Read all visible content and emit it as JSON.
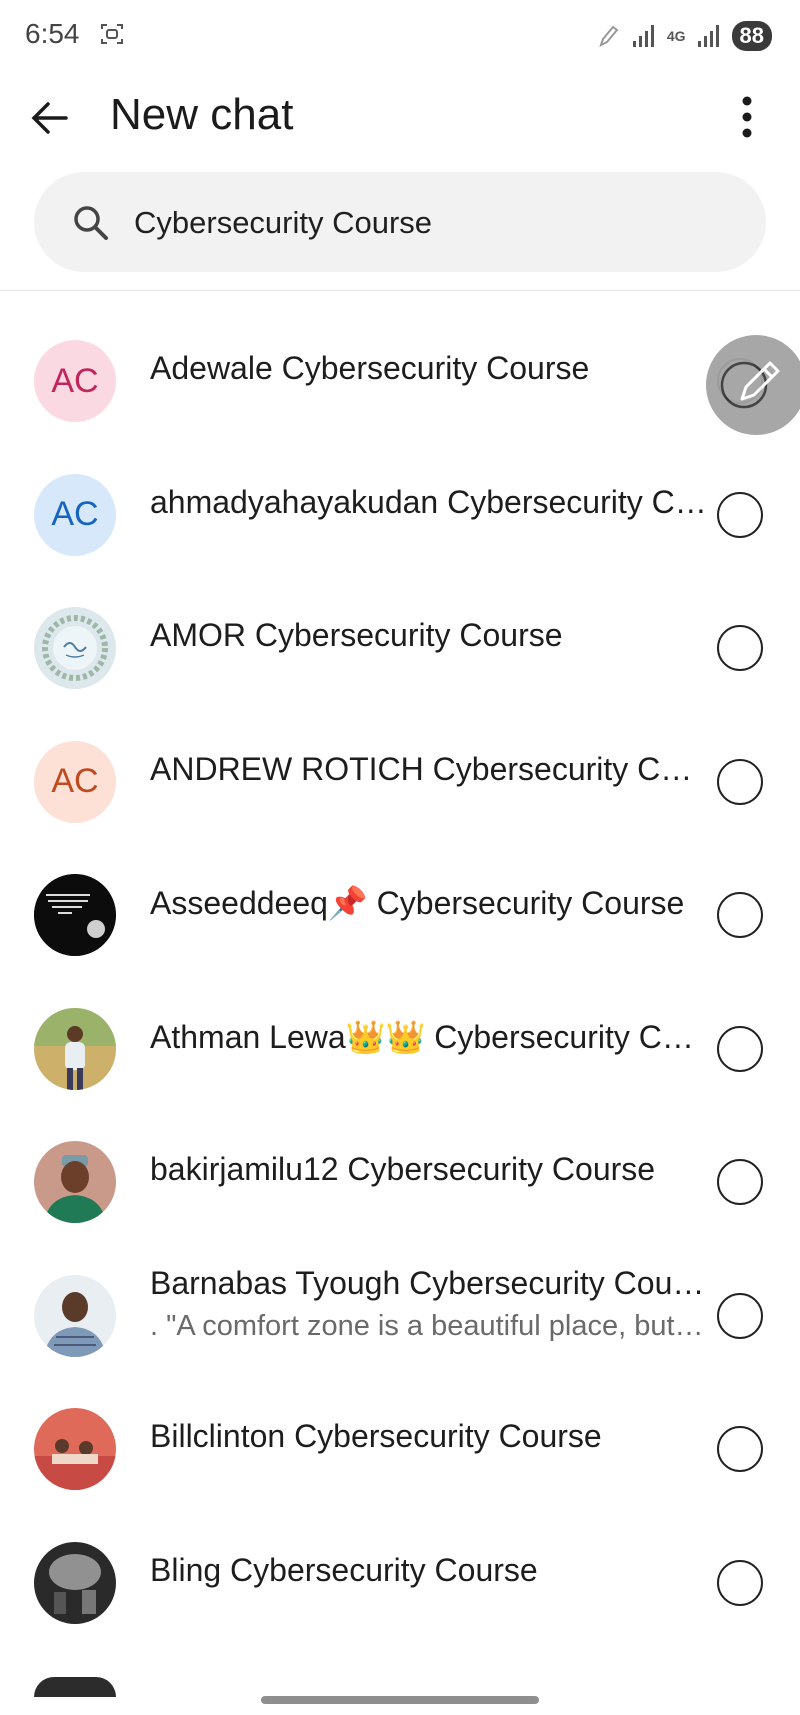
{
  "status_bar": {
    "time": "6:54",
    "battery": "88",
    "network": "4G"
  },
  "app_bar": {
    "title": "New chat"
  },
  "search": {
    "value": "Cybersecurity Course"
  },
  "contacts": [
    {
      "name": "Adewale Cybersecurity Course",
      "initials": "AC",
      "avatar_bg": "#fbd9e2",
      "avatar_fg": "#c2255c"
    },
    {
      "name": "ahmadyahayakudan Cybersecurity Course",
      "initials": "AC",
      "avatar_bg": "#d8e8fb",
      "avatar_fg": "#1565c0"
    },
    {
      "name": "AMOR Cybersecurity Course",
      "avatar_icon": "floral-wreath-photo"
    },
    {
      "name": "ANDREW ROTICH Cybersecurity Course",
      "initials": "AC",
      "avatar_bg": "#fde0d6",
      "avatar_fg": "#c04a1f"
    },
    {
      "name": "Asseeddeeq📌 Cybersecurity Course",
      "avatar_icon": "quote-photo"
    },
    {
      "name": "Athman Lewa👑👑 Cybersecurity Course",
      "avatar_icon": "person-field-photo"
    },
    {
      "name": "bakirjamilu12 Cybersecurity Course",
      "avatar_icon": "person-cap-photo"
    },
    {
      "name": "Barnabas Tyough Cybersecurity Course",
      "subtitle": ". \"A comfort zone is a beautiful place, but nothing ever grows there\"",
      "avatar_icon": "person-photo"
    },
    {
      "name": "Billclinton Cybersecurity Course",
      "avatar_icon": "group-photo"
    },
    {
      "name": "Bling Cybersecurity Course",
      "avatar_icon": "bw-room-photo"
    }
  ],
  "colors": {
    "search_bg": "#f2f2f2",
    "fab_bg": "#a3a3a3"
  }
}
